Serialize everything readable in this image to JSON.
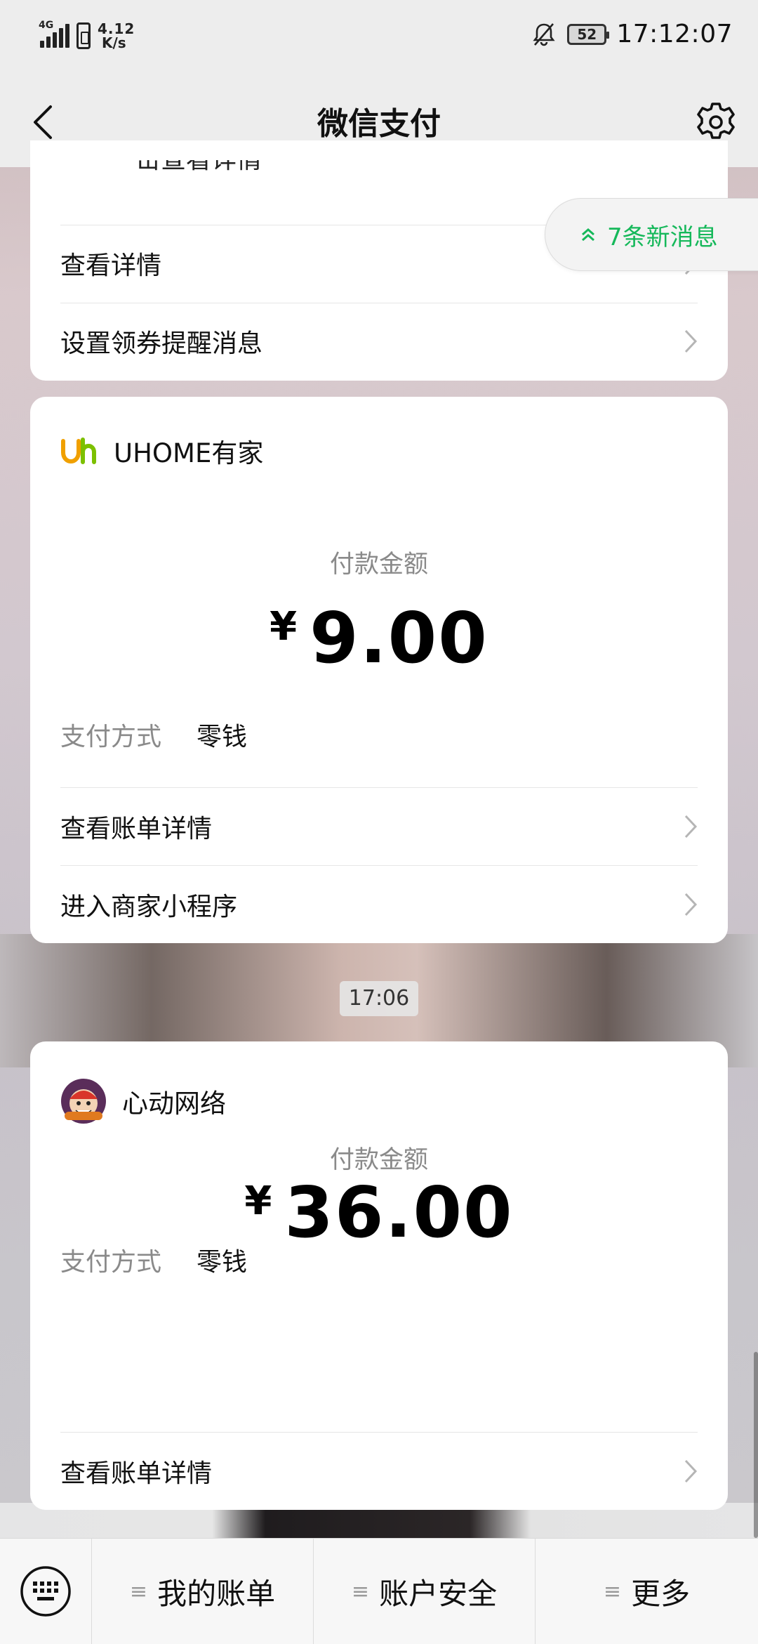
{
  "status_bar": {
    "network": "4G",
    "speed_value": "4.12",
    "speed_unit": "K/s",
    "battery": "52",
    "time": "17:12:07"
  },
  "app_bar": {
    "title": "微信支付"
  },
  "top_card": {
    "cut_text": "击查看详情",
    "row1": "查看详情",
    "row2": "设置领券提醒消息"
  },
  "new_messages": "7条新消息",
  "payments": [
    {
      "merchant": "UHOME有家",
      "amount_label": "付款金额",
      "currency": "¥",
      "amount": "9.00",
      "pay_method_label": "支付方式",
      "pay_method_value": "零钱",
      "link1": "查看账单详情",
      "link2": "进入商家小程序"
    },
    {
      "merchant": "心动网络",
      "amount_label": "付款金额",
      "currency": "¥",
      "amount": "36.00",
      "pay_method_label": "支付方式",
      "pay_method_value": "零钱",
      "link1": "查看账单详情"
    }
  ],
  "timestamp": "17:06",
  "bottom_menu": {
    "item1": "我的账单",
    "item2": "账户安全",
    "item3": "更多"
  },
  "colors": {
    "accent_green": "#15b85a",
    "uhome_orange": "#f0a000",
    "uhome_green": "#7cc000"
  }
}
